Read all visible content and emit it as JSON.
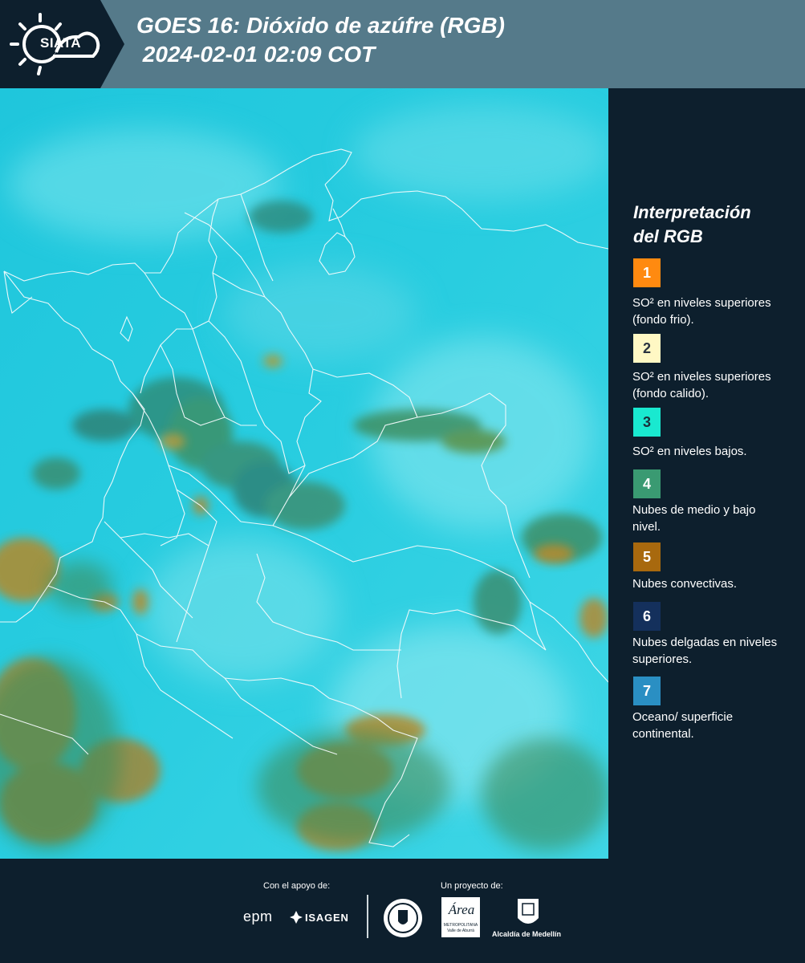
{
  "header": {
    "logo_text": "SIATA",
    "title_line1": "GOES 16: Dióxido de azúfre (RGB)",
    "title_line2": " 2024-02-01 02:09 COT"
  },
  "legend": {
    "title_line1": "Interpretación",
    "title_line2": "del RGB",
    "items": [
      {
        "num": "1",
        "color": "#ff8a10",
        "text_color": "#ffffff",
        "label": "SO² en niveles superiores (fondo frio)."
      },
      {
        "num": "2",
        "color": "#fff8c4",
        "text_color": "#2a3340",
        "label": "SO² en niveles superiores (fondo calido)."
      },
      {
        "num": "3",
        "color": "#19e9d0",
        "text_color": "#1a2f3a",
        "label": "SO² en niveles bajos."
      },
      {
        "num": "4",
        "color": "#3a9a72",
        "text_color": "#ffffff",
        "label": "Nubes de medio y bajo nivel."
      },
      {
        "num": "5",
        "color": "#a8690e",
        "text_color": "#ffffff",
        "label": "Nubes convectivas."
      },
      {
        "num": "6",
        "color": "#14305c",
        "text_color": "#ffffff",
        "label": "Nubes delgadas en niveles superiores."
      },
      {
        "num": "7",
        "color": "#2a8fc3",
        "text_color": "#ffffff",
        "label": "Oceano/ superficie continental."
      }
    ]
  },
  "footer": {
    "support_label": "Con el apoyo de:",
    "project_label": "Un proyecto de:",
    "epm": "epm",
    "isagen": "ISAGEN",
    "metropolitana": "METROPOLITANA",
    "valle": "Valle de Aburrá",
    "area": "Área",
    "alcaldia": "Alcaldía de Medellín"
  }
}
